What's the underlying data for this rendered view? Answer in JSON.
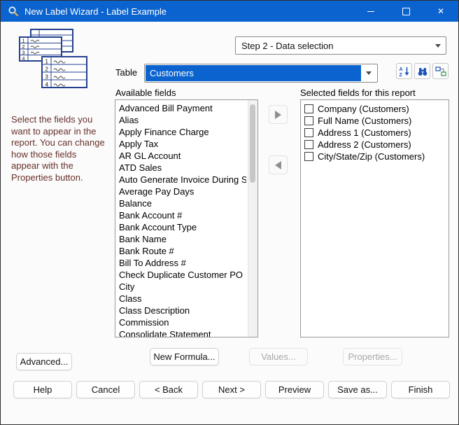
{
  "window": {
    "title": "New Label Wizard - Label Example",
    "controls": {
      "close": "✕"
    }
  },
  "colors": {
    "titlebar": "#0b63cf",
    "accent": "#0b63cf",
    "sidebar_text": "#66302a"
  },
  "step_selector": {
    "value": "Step 2 - Data selection"
  },
  "sidebar": {
    "description": "Select the fields you want to appear in the report. You can change how those fields appear with the Properties button."
  },
  "table_section": {
    "label": "Table",
    "value": "Customers"
  },
  "available": {
    "label": "Available fields",
    "items": [
      "Advanced Bill Payment",
      "Alias",
      "Apply Finance Charge",
      "Apply Tax",
      "AR GL Account",
      "ATD Sales",
      "Auto Generate Invoice During Shipr",
      "Average Pay Days",
      "Balance",
      "Bank Account #",
      "Bank Account Type",
      "Bank Name",
      "Bank Route #",
      "Bill To Address #",
      "Check Duplicate Customer PO",
      "City",
      "Class",
      "Class Description",
      "Commission",
      "Consolidate Statement"
    ]
  },
  "selected": {
    "label": "Selected fields for this report",
    "items": [
      "Company (Customers)",
      "Full Name (Customers)",
      "Address 1 (Customers)",
      "Address 2 (Customers)",
      "City/State/Zip (Customers)"
    ]
  },
  "actions": {
    "advanced": "Advanced...",
    "new_formula": "New Formula...",
    "values": "Values...",
    "properties": "Properties..."
  },
  "footer": {
    "help": "Help",
    "cancel": "Cancel",
    "back": "< Back",
    "next": "Next >",
    "preview": "Preview",
    "save_as": "Save as...",
    "finish": "Finish"
  }
}
